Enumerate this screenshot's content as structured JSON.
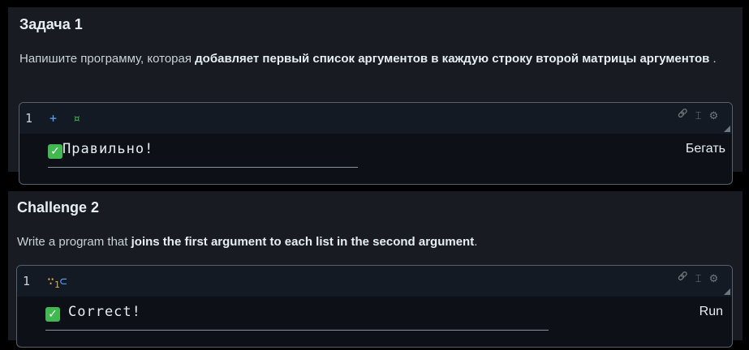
{
  "challenge1": {
    "title": "Задача 1",
    "desc_start": "Напишите программу, которая ",
    "desc_bold": "добавляет первый список аргументов в каждую строку второй матрицы аргументов",
    "desc_end": " .",
    "line_number": "1",
    "code_token1": "+",
    "code_token2": "¤",
    "result_check": "✓",
    "result_text": "Правильно!",
    "run_label": "Бегать"
  },
  "challenge2": {
    "title": "Challenge 2",
    "desc_start": "Write a program that ",
    "desc_bold": "joins the first argument to each list in the second argument",
    "desc_end": ".",
    "line_number": "1",
    "code_dots": "∵",
    "code_sub": "1",
    "code_op": "⊂",
    "result_check": "✓",
    "result_text": "Correct!",
    "run_label": "Run"
  },
  "toolbar": {
    "icons": [
      "link-icon",
      "text-cursor-icon",
      "settings-icon"
    ],
    "link_glyph": "🔗",
    "cursor_glyph": "⌶",
    "gear_glyph": "⚙"
  },
  "colors": {
    "page_bg": "#000000",
    "panel_bg": "#181b22",
    "editor_bg": "#0d1117",
    "success_green": "#3fb950",
    "accent_blue": "#58a6ff",
    "accent_yellow": "#e3b341"
  }
}
